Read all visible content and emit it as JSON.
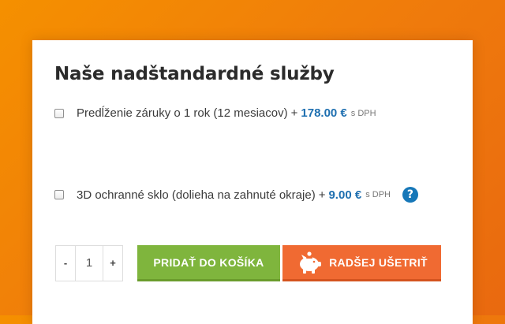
{
  "services": {
    "title": "Naše nadštandardné služby",
    "options": [
      {
        "label": "Predĺženie záruky o 1 rok (12 mesiacov)",
        "plus": "+",
        "price": "178.00 €",
        "vat": "s DPH",
        "checked": false
      },
      {
        "label": "3D ochranné sklo (dolieha na zahnuté okraje)",
        "plus": "+",
        "price": "9.00 €",
        "vat": "s DPH",
        "checked": false,
        "help_icon": "?"
      }
    ]
  },
  "cart": {
    "decrement_label": "-",
    "quantity": "1",
    "increment_label": "+",
    "add_to_cart_label": "PRIDAŤ DO KOŠÍKA",
    "save_label": "RADŠEJ UŠETRIŤ",
    "save_icon": "piggy-bank-icon"
  },
  "colors": {
    "background": "#f08a0a",
    "price": "#1e6fb0",
    "add_to_cart": "#7fb53d",
    "save": "#f06a32",
    "help": "#1677b8"
  }
}
